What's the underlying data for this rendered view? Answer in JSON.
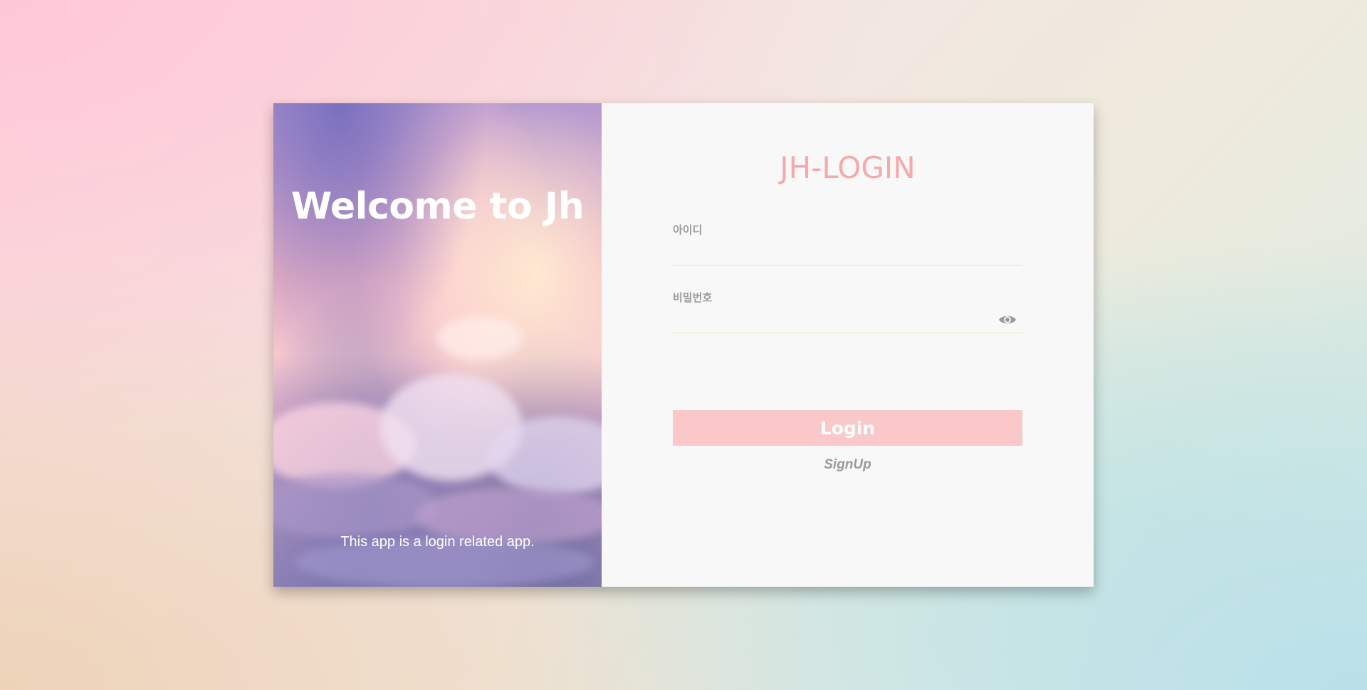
{
  "hero": {
    "title": "Welcome to Jh",
    "caption": "This app is a login related app."
  },
  "form": {
    "brand_title": "JH-LOGIN",
    "id_label": "아이디",
    "id_value": "",
    "password_label": "비밀번호",
    "password_value": "",
    "login_label": "Login",
    "signup_label": "SignUp"
  },
  "icons": {
    "password_toggle": "eye-icon"
  },
  "colors": {
    "brand_pink": "#f5a9ab",
    "button_pink": "#fac8c8",
    "label_gray": "#9a9a9a",
    "card_bg": "#f8f8f8"
  }
}
